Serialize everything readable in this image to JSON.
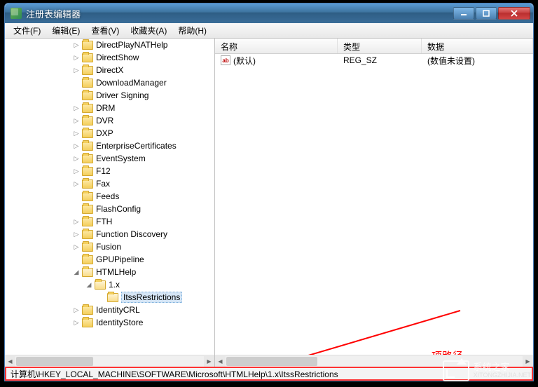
{
  "window": {
    "title": "注册表编辑器"
  },
  "menu": {
    "file": "文件(F)",
    "edit": "编辑(E)",
    "view": "查看(V)",
    "favorites": "收藏夹(A)",
    "help": "帮助(H)"
  },
  "tree": {
    "base_indent": 96,
    "items": [
      {
        "label": "DirectPlayNATHelp",
        "toggle": "▷",
        "indent": 0
      },
      {
        "label": "DirectShow",
        "toggle": "▷",
        "indent": 0
      },
      {
        "label": "DirectX",
        "toggle": "▷",
        "indent": 0
      },
      {
        "label": "DownloadManager",
        "toggle": "",
        "indent": 0
      },
      {
        "label": "Driver Signing",
        "toggle": "",
        "indent": 0
      },
      {
        "label": "DRM",
        "toggle": "▷",
        "indent": 0
      },
      {
        "label": "DVR",
        "toggle": "▷",
        "indent": 0
      },
      {
        "label": "DXP",
        "toggle": "▷",
        "indent": 0
      },
      {
        "label": "EnterpriseCertificates",
        "toggle": "▷",
        "indent": 0
      },
      {
        "label": "EventSystem",
        "toggle": "▷",
        "indent": 0
      },
      {
        "label": "F12",
        "toggle": "▷",
        "indent": 0
      },
      {
        "label": "Fax",
        "toggle": "▷",
        "indent": 0
      },
      {
        "label": "Feeds",
        "toggle": "",
        "indent": 0
      },
      {
        "label": "FlashConfig",
        "toggle": "",
        "indent": 0
      },
      {
        "label": "FTH",
        "toggle": "▷",
        "indent": 0
      },
      {
        "label": "Function Discovery",
        "toggle": "▷",
        "indent": 0
      },
      {
        "label": "Fusion",
        "toggle": "▷",
        "indent": 0
      },
      {
        "label": "GPUPipeline",
        "toggle": "",
        "indent": 0
      },
      {
        "label": "HTMLHelp",
        "toggle": "◢",
        "indent": 0,
        "open": true
      },
      {
        "label": "1.x",
        "toggle": "◢",
        "indent": 1,
        "open": true
      },
      {
        "label": "ItssRestrictions",
        "toggle": "",
        "indent": 2,
        "selected": true,
        "open": true
      },
      {
        "label": "IdentityCRL",
        "toggle": "▷",
        "indent": 0
      },
      {
        "label": "IdentityStore",
        "toggle": "▷",
        "indent": 0
      }
    ]
  },
  "list": {
    "columns": {
      "name": "名称",
      "type": "类型",
      "data": "数据"
    },
    "rows": [
      {
        "name": "(默认)",
        "type": "REG_SZ",
        "data": "(数值未设置)"
      }
    ]
  },
  "annotation": {
    "label": "项路径"
  },
  "statusbar": {
    "path": "计算机\\HKEY_LOCAL_MACHINE\\SOFTWARE\\Microsoft\\HTMLHelp\\1.x\\ItssRestrictions"
  },
  "watermark": {
    "name": "系统之家",
    "url": "XITONGZHIJIA.NET"
  }
}
